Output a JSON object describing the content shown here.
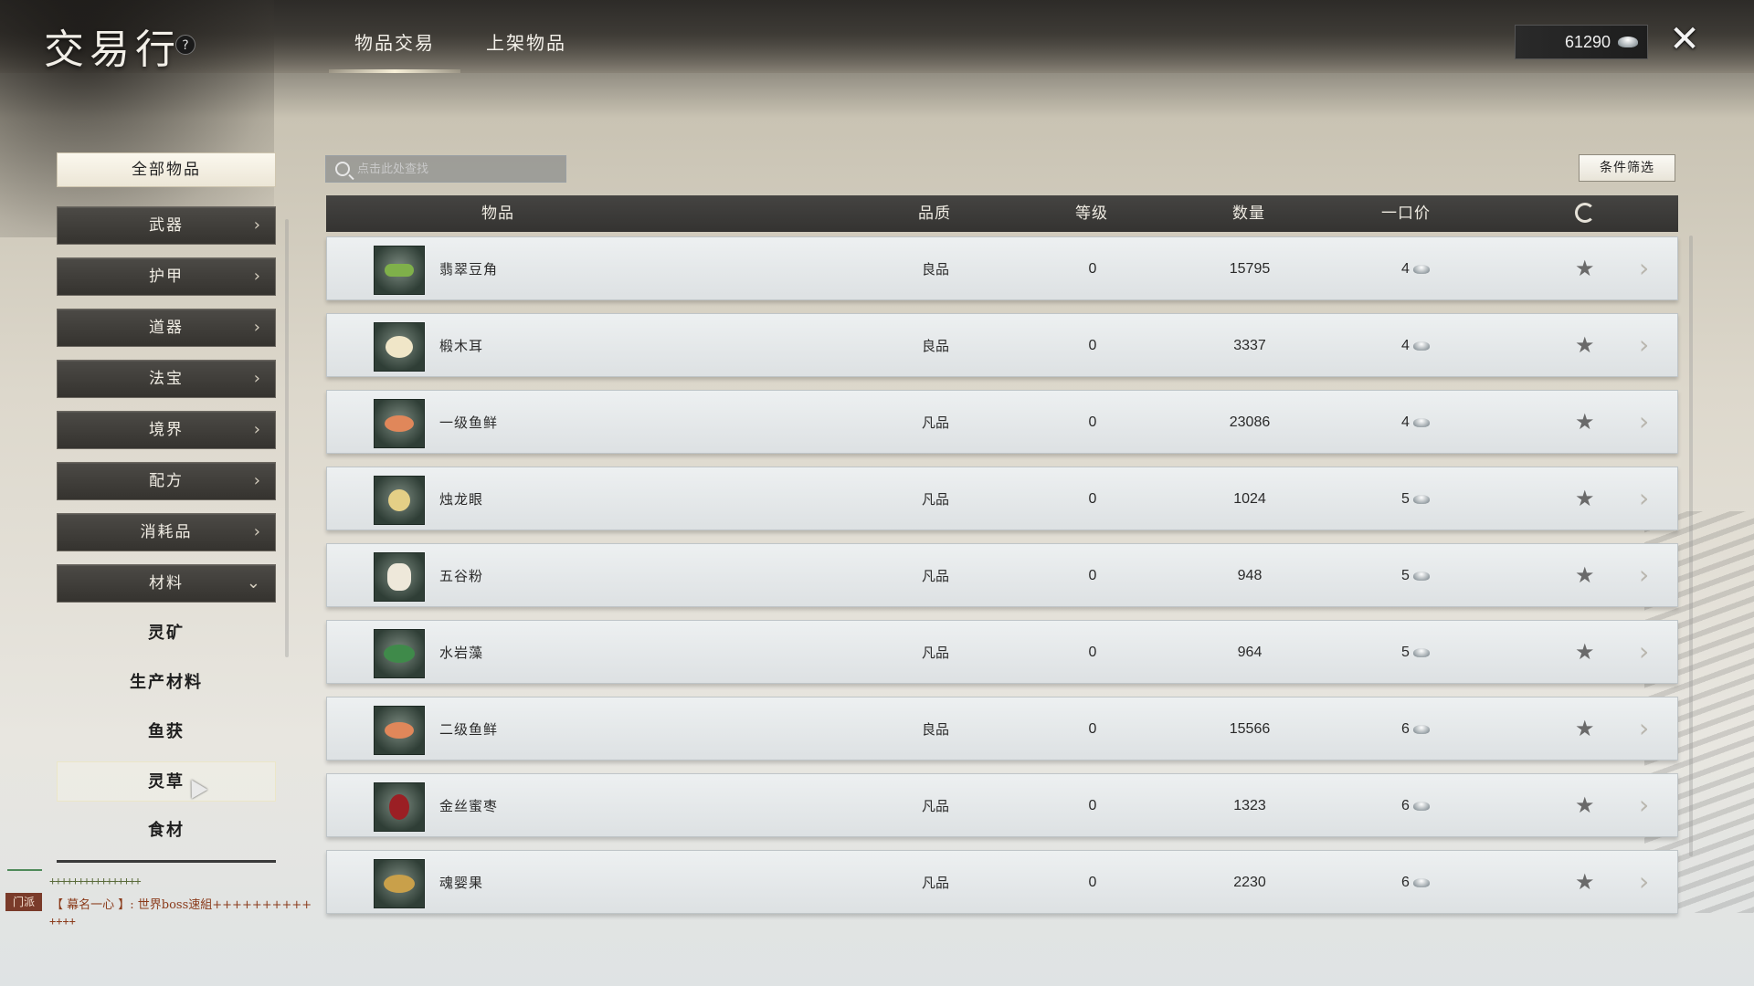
{
  "header": {
    "title": "交易行",
    "help_icon": "?",
    "tabs": [
      {
        "label": "物品交易",
        "active": true
      },
      {
        "label": "上架物品",
        "active": false
      }
    ],
    "currency_amount": "61290",
    "close_glyph": "✕"
  },
  "sidebar": {
    "all_items_label": "全部物品",
    "categories": [
      {
        "label": "武器",
        "arrow": "›"
      },
      {
        "label": "护甲",
        "arrow": "›"
      },
      {
        "label": "道器",
        "arrow": "›"
      },
      {
        "label": "法宝",
        "arrow": "›"
      },
      {
        "label": "境界",
        "arrow": "›"
      },
      {
        "label": "配方",
        "arrow": "›"
      },
      {
        "label": "消耗品",
        "arrow": "›"
      },
      {
        "label": "材料",
        "arrow": "⌄"
      }
    ],
    "subcategories": [
      "灵矿",
      "生产材料",
      "鱼获",
      "灵草",
      "食材"
    ]
  },
  "chat": {
    "line1": "++++++++++++++++",
    "tag": "门派",
    "message": "【 幕名一心 】: 世界boss速組++++++++++",
    "line3": "++++"
  },
  "search": {
    "placeholder": "点击此处查找"
  },
  "filter_label": "条件筛选",
  "table": {
    "headers": {
      "item": "物品",
      "quality": "品质",
      "level": "等级",
      "quantity": "数量",
      "price": "一口价"
    },
    "rows": [
      {
        "name": "翡翠豆角",
        "quality": "良品",
        "level": "0",
        "quantity": "15795",
        "price": "4",
        "icon": "green-bean-icon",
        "color": "#7fb04a"
      },
      {
        "name": "椴木耳",
        "quality": "良品",
        "level": "0",
        "quantity": "3337",
        "price": "4",
        "icon": "white-fungus-icon",
        "color": "#f0e6c8"
      },
      {
        "name": "一级鱼鲜",
        "quality": "凡品",
        "level": "0",
        "quantity": "23086",
        "price": "4",
        "icon": "fish-fillet-icon",
        "color": "#e0875a"
      },
      {
        "name": "烛龙眼",
        "quality": "凡品",
        "level": "0",
        "quantity": "1024",
        "price": "5",
        "icon": "longan-icon",
        "color": "#e4cf86"
      },
      {
        "name": "五谷粉",
        "quality": "凡品",
        "level": "0",
        "quantity": "948",
        "price": "5",
        "icon": "flour-sack-icon",
        "color": "#eee8da"
      },
      {
        "name": "水岩藻",
        "quality": "凡品",
        "level": "0",
        "quantity": "964",
        "price": "5",
        "icon": "seaweed-icon",
        "color": "#3f8a4a"
      },
      {
        "name": "二级鱼鲜",
        "quality": "良品",
        "level": "0",
        "quantity": "15566",
        "price": "6",
        "icon": "fish-fillet-icon",
        "color": "#e0875a"
      },
      {
        "name": "金丝蜜枣",
        "quality": "凡品",
        "level": "0",
        "quantity": "1323",
        "price": "6",
        "icon": "jujube-icon",
        "color": "#9b1f24"
      },
      {
        "name": "魂婴果",
        "quality": "凡品",
        "level": "0",
        "quantity": "2230",
        "price": "6",
        "icon": "potato-fruit-icon",
        "color": "#c9a04a"
      }
    ],
    "star_glyph": "★",
    "go_glyph": "›"
  }
}
